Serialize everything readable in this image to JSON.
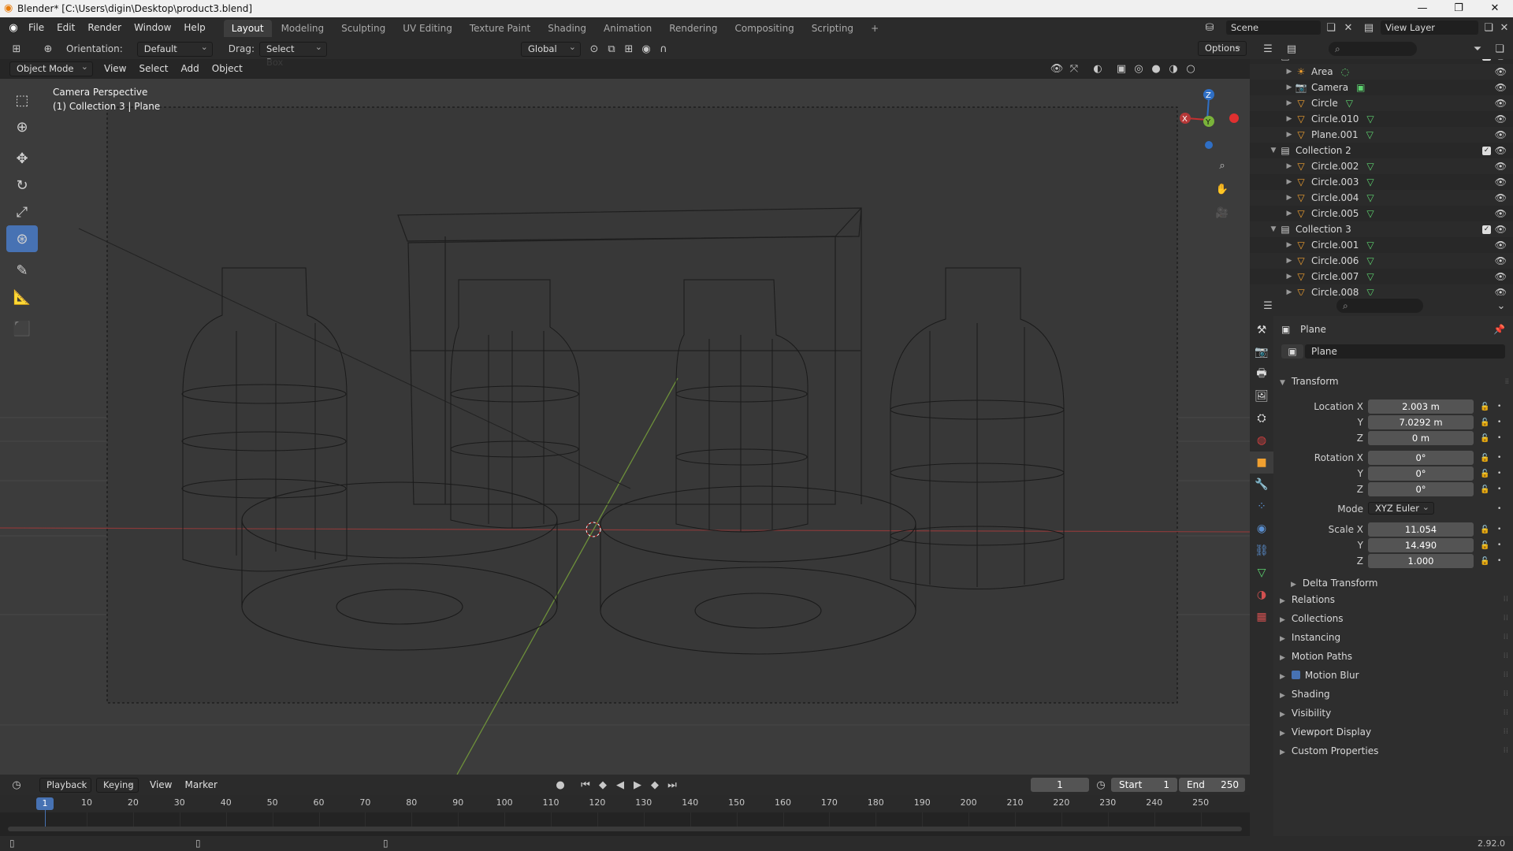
{
  "window": {
    "title": "Blender* [C:\\Users\\digin\\Desktop\\product3.blend]",
    "min": "—",
    "max": "❐",
    "close": "✕"
  },
  "menu": [
    "File",
    "Edit",
    "Render",
    "Window",
    "Help"
  ],
  "workspaces": [
    "Layout",
    "Modeling",
    "Sculpting",
    "UV Editing",
    "Texture Paint",
    "Shading",
    "Animation",
    "Rendering",
    "Compositing",
    "Scripting"
  ],
  "workspace_add": "+",
  "scene": {
    "name": "Scene",
    "view_layer": "View Layer"
  },
  "tool_header": {
    "orientation_label": "Orientation:",
    "orientation_value": "Default",
    "drag_label": "Drag:",
    "drag_value": "Select Box",
    "transform_orientation": "Global",
    "options": "Options"
  },
  "view_header": {
    "mode": "Object Mode",
    "menus": [
      "View",
      "Select",
      "Add",
      "Object"
    ]
  },
  "viewport": {
    "line1": "Camera Perspective",
    "line2": "(1) Collection 3 | Plane",
    "gizmo": {
      "z": "Z",
      "y": "Y",
      "x": "X"
    }
  },
  "outliner": {
    "rows": [
      {
        "name": "Collection",
        "type": "collection",
        "indent": 1
      },
      {
        "name": "Area",
        "type": "light",
        "indent": 2
      },
      {
        "name": "Camera",
        "type": "camera",
        "indent": 2
      },
      {
        "name": "Circle",
        "type": "mesh",
        "indent": 2
      },
      {
        "name": "Circle.010",
        "type": "mesh",
        "indent": 2
      },
      {
        "name": "Plane.001",
        "type": "mesh",
        "indent": 2
      },
      {
        "name": "Collection 2",
        "type": "collection",
        "indent": 1
      },
      {
        "name": "Circle.002",
        "type": "mesh",
        "indent": 2
      },
      {
        "name": "Circle.003",
        "type": "mesh",
        "indent": 2
      },
      {
        "name": "Circle.004",
        "type": "mesh",
        "indent": 2
      },
      {
        "name": "Circle.005",
        "type": "mesh",
        "indent": 2
      },
      {
        "name": "Collection 3",
        "type": "collection",
        "indent": 1
      },
      {
        "name": "Circle.001",
        "type": "mesh",
        "indent": 2
      },
      {
        "name": "Circle.006",
        "type": "mesh",
        "indent": 2
      },
      {
        "name": "Circle.007",
        "type": "mesh",
        "indent": 2
      },
      {
        "name": "Circle.008",
        "type": "mesh",
        "indent": 2
      }
    ]
  },
  "properties": {
    "object_name": "Plane",
    "data_name": "Plane",
    "transform_label": "Transform",
    "location_label": "Location X",
    "location": [
      "2.003 m",
      "7.0292 m",
      "0 m"
    ],
    "rotation_label": "Rotation X",
    "rotation": [
      "0°",
      "0°",
      "0°"
    ],
    "mode_label": "Mode",
    "mode_value": "XYZ Euler",
    "scale_label": "Scale X",
    "scale": [
      "11.054",
      "14.490",
      "1.000"
    ],
    "axis_y": "Y",
    "axis_z": "Z",
    "delta": "Delta Transform",
    "panels": [
      "Relations",
      "Collections",
      "Instancing",
      "Motion Paths",
      "Motion Blur",
      "Shading",
      "Visibility",
      "Viewport Display",
      "Custom Properties"
    ]
  },
  "timeline": {
    "menus": [
      "Playback",
      "Keying",
      "View",
      "Marker"
    ],
    "current_frame": "1",
    "start_label": "Start",
    "start": "1",
    "end_label": "End",
    "end": "250",
    "ticks": [
      "10",
      "20",
      "30",
      "40",
      "50",
      "60",
      "70",
      "80",
      "90",
      "100",
      "110",
      "120",
      "130",
      "140",
      "150",
      "160",
      "170",
      "180",
      "190",
      "200",
      "210",
      "220",
      "230",
      "240",
      "250"
    ],
    "frame_marker": "1"
  },
  "status": {
    "version": "2.92.0"
  }
}
